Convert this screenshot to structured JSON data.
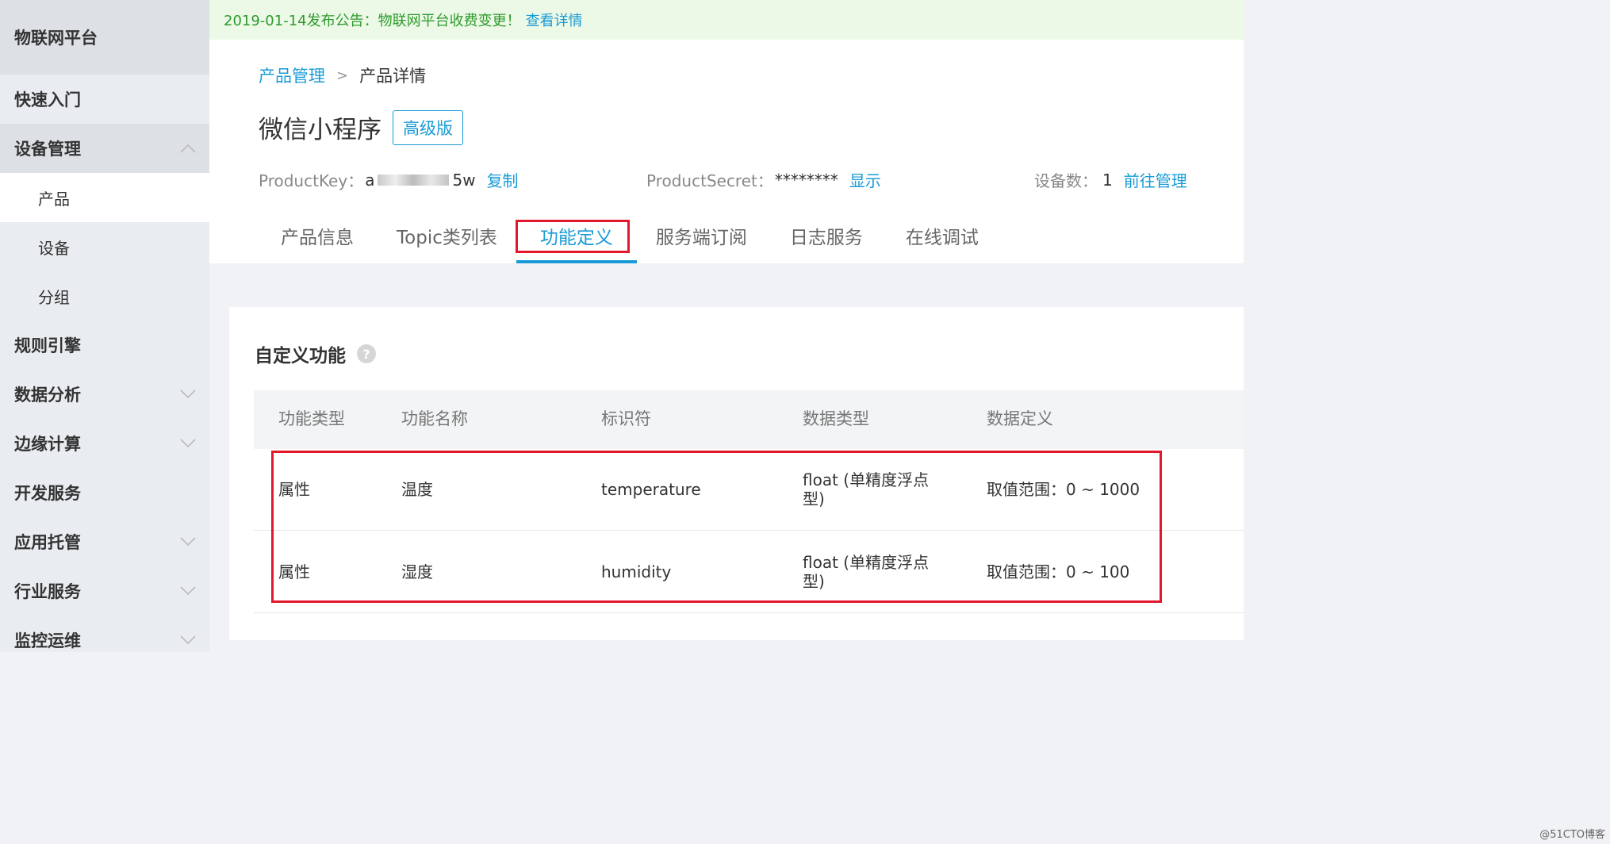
{
  "sidebar": {
    "title": "物联网平台",
    "items": [
      {
        "label": "快速入门"
      },
      {
        "label": "设备管理"
      },
      {
        "label": "产品"
      },
      {
        "label": "设备"
      },
      {
        "label": "分组"
      },
      {
        "label": "规则引擎"
      },
      {
        "label": "数据分析"
      },
      {
        "label": "边缘计算"
      },
      {
        "label": "开发服务"
      },
      {
        "label": "应用托管"
      },
      {
        "label": "行业服务"
      },
      {
        "label": "监控运维"
      }
    ]
  },
  "notice": {
    "text": "2019-01-14发布公告：物联网平台收费变更！",
    "link": "查看详情"
  },
  "breadcrumb": {
    "parent": "产品管理",
    "separator": ">",
    "current": "产品详情"
  },
  "product": {
    "name": "微信小程序",
    "edition": "高级版",
    "key_label": "ProductKey：",
    "key_prefix": "a",
    "key_suffix": "5w",
    "copy_action": "复制",
    "secret_label": "ProductSecret：",
    "secret_value": "********",
    "show_action": "显示",
    "device_count_label": "设备数：",
    "device_count": "1",
    "manage_action": "前往管理"
  },
  "tabs": [
    {
      "label": "产品信息"
    },
    {
      "label": "Topic类列表"
    },
    {
      "label": "功能定义"
    },
    {
      "label": "服务端订阅"
    },
    {
      "label": "日志服务"
    },
    {
      "label": "在线调试"
    }
  ],
  "panel": {
    "title": "自定义功能",
    "help_glyph": "?"
  },
  "table": {
    "headers": [
      "功能类型",
      "功能名称",
      "标识符",
      "数据类型",
      "数据定义"
    ],
    "rows": [
      [
        "属性",
        "温度",
        "temperature",
        "float (单精度浮点型)",
        "取值范围：0 ~ 1000"
      ],
      [
        "属性",
        "湿度",
        "humidity",
        "float (单精度浮点型)",
        "取值范围：0 ~ 100"
      ]
    ]
  },
  "watermark": "@51CTO博客",
  "colors": {
    "accent": "#1a9bd7",
    "highlight": "#e3182d",
    "notice_text": "#2d9a2d",
    "notice_bg": "#ecf9e6"
  }
}
